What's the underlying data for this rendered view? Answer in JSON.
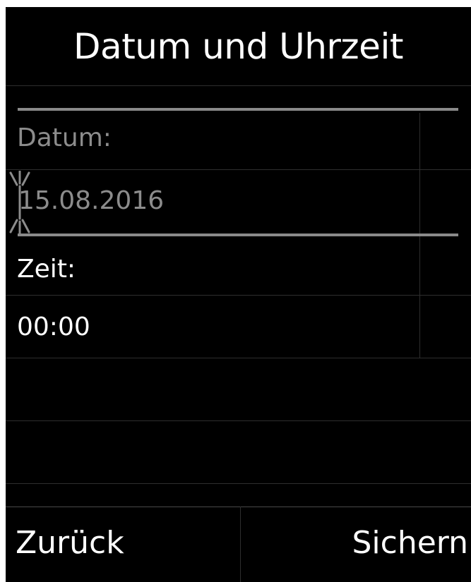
{
  "header": {
    "title": "Datum und Uhrzeit"
  },
  "fields": [
    {
      "label": "Datum:",
      "value": "15.08.2016",
      "selected": true
    },
    {
      "label": "Zeit:",
      "value": "00:00",
      "selected": false
    }
  ],
  "softkeys": {
    "left": "Zurück",
    "right": "Sichern"
  },
  "colors": {
    "background": "#000000",
    "text": "#ffffff",
    "selected_text": "#8c8c8c",
    "selection_bar": "#8a8a8a"
  },
  "icons": {
    "cursor": "blinking-edit-cursor-icon"
  }
}
